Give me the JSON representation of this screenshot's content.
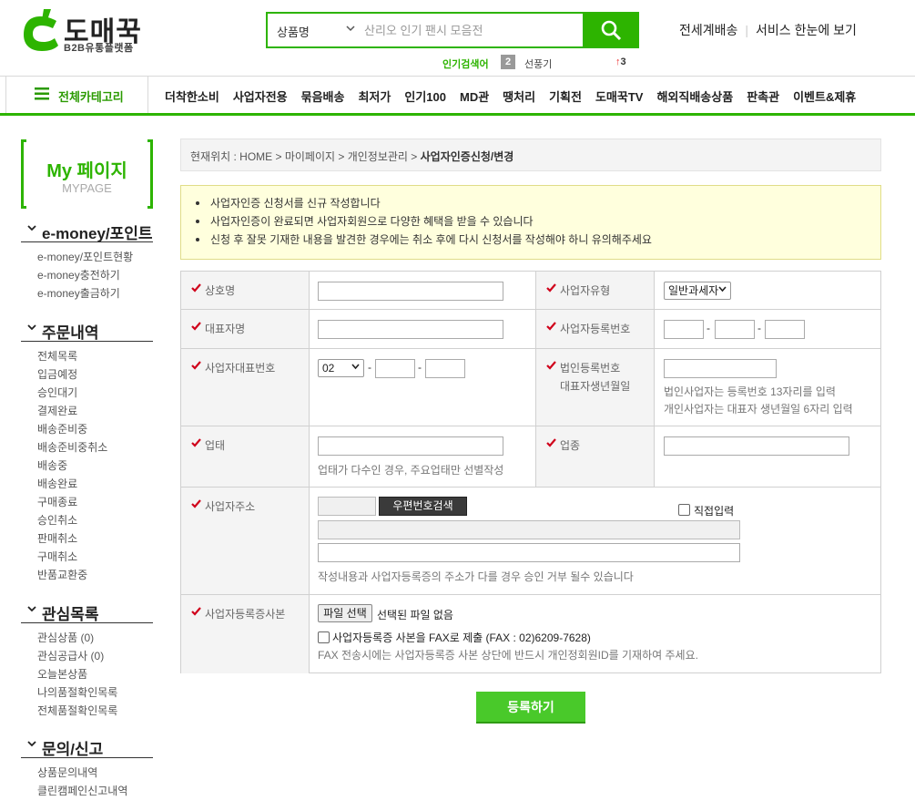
{
  "header": {
    "logo_text": "도매꾹",
    "logo_sub": "B2B유통플랫폼",
    "search_category": "상품명",
    "search_placeholder": "산리오 인기 팬시 모음전",
    "trend_label": "인기검색어",
    "trend_rank": "2",
    "trend_word": "선풍기",
    "trend_change": "3",
    "link_global": "전세계배송",
    "link_overview": "서비스 한눈에 보기"
  },
  "nav": {
    "category_label": "전체카테고리",
    "items": [
      "더착한소비",
      "사업자전용",
      "묶음배송",
      "최저가",
      "인기100",
      "MD관",
      "땡처리",
      "기획전",
      "도매꾹TV",
      "해외직배송상품",
      "판촉관",
      "이벤트&제휴"
    ]
  },
  "sidebar": {
    "title": "My 페이지",
    "subtitle": "MYPAGE",
    "sections": [
      {
        "title": "e-money/포인트",
        "items": [
          "e-money/포인트현황",
          "e-money충전하기",
          "e-money출금하기"
        ]
      },
      {
        "title": "주문내역",
        "items": [
          "전체목록",
          "입금예정",
          "승인대기",
          "결제완료",
          "배송준비중",
          "배송준비중취소",
          "배송중",
          "배송완료",
          "구매종료",
          "승인취소",
          "판매취소",
          "구매취소",
          "반품교환중"
        ]
      },
      {
        "title": "관심목록",
        "items": [
          "관심상품 (0)",
          "관심공급사 (0)",
          "오늘본상품",
          "나의품절확인목록",
          "전체품절확인목록"
        ]
      },
      {
        "title": "문의/신고",
        "items": [
          "상품문의내역",
          "클린캠페인신고내역"
        ]
      }
    ]
  },
  "breadcrumb": {
    "prefix": "현재위치 : HOME > 마이페이지 > 개인정보관리 > ",
    "current": "사업자인증신청/변경"
  },
  "notice": [
    "사업자인증 신청서를 신규 작성합니다",
    "사업자인증이 완료되면 사업자회원으로 다양한 혜택을 받을 수 있습니다",
    "신청 후 잘못 기재한 내용을 발견한 경우에는 취소 후에 다시 신청서를 작성해야 하니 유의해주세요"
  ],
  "form": {
    "company_name_label": "상호명",
    "biz_type_label": "사업자유형",
    "biz_type_value": "일반과세자",
    "ceo_label": "대표자명",
    "biz_no_label": "사업자등록번호",
    "phone_label": "사업자대표번호",
    "phone_area_value": "02",
    "corp_no_label": "법인등록번호",
    "birth_label": "대표자생년월일",
    "corp_hint1": "법인사업자는 등록번호 13자리를 입력",
    "corp_hint2": "개인사업자는 대표자 생년월일 6자리 입력",
    "business_label": "업태",
    "business_hint": "업태가 다수인 경우, 주요업태만 선별작성",
    "category_label": "업종",
    "address_label": "사업자주소",
    "zip_button": "우편번호검색",
    "direct_input_label": "직접입력",
    "address_hint": "작성내용과 사업자등록증의 주소가 다를 경우 승인 거부 될수 있습니다",
    "cert_label": "사업자등록증사본",
    "file_button": "파일 선택",
    "file_status": "선택된 파일 없음",
    "fax_label": "사업자등록증 사본을 FAX로 제출 (FAX : 02)6209-7628)",
    "fax_hint": "FAX 전송시에는 사업자등록증 사본 상단에 반드시 개인정회원ID를 기재하여 주세요.",
    "submit": "등록하기"
  },
  "colors": {
    "brand_green": "#2db400",
    "check_red": "#d0021b",
    "notice_bg": "#ffffdd"
  }
}
